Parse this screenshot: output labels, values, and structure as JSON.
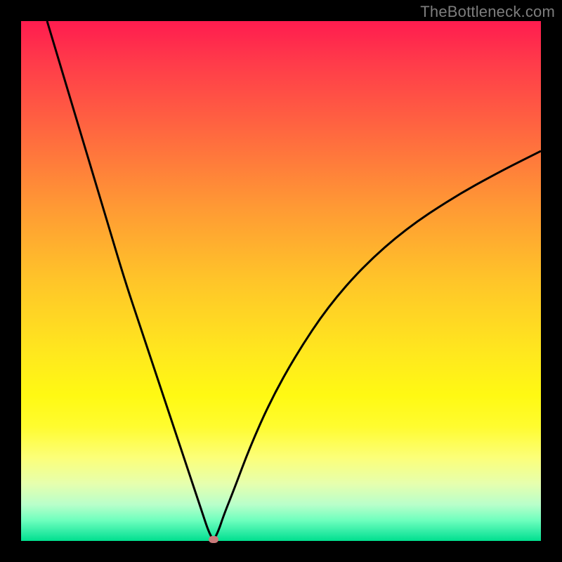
{
  "watermark": "TheBottleneck.com",
  "colors": {
    "frame": "#000000",
    "curve": "#000000",
    "marker": "#c97a7a"
  },
  "chart_data": {
    "type": "line",
    "title": "",
    "xlabel": "",
    "ylabel": "",
    "xlim": [
      0,
      100
    ],
    "ylim": [
      0,
      100
    ],
    "grid": false,
    "legend": false,
    "note": "V-shaped curve: value drops to ~0 near x≈37 and rises toward both sides; upper y ≈ strong mismatch (red), y≈0 ≈ balanced (green).",
    "minimum_point": {
      "x": 37,
      "y": 0
    },
    "marker": {
      "x": 37,
      "y": 0
    },
    "series": [
      {
        "name": "curve",
        "x": [
          5,
          8,
          11,
          14,
          17,
          20,
          23,
          26,
          29,
          32,
          34,
          35,
          36,
          37,
          38,
          39,
          41,
          44,
          48,
          53,
          59,
          66,
          74,
          83,
          92,
          100
        ],
        "y": [
          100,
          90,
          80,
          70,
          60,
          50,
          41,
          32,
          23,
          14,
          8,
          5,
          2,
          0,
          2,
          5,
          10,
          18,
          27,
          36,
          45,
          53,
          60,
          66,
          71,
          75
        ]
      }
    ]
  }
}
